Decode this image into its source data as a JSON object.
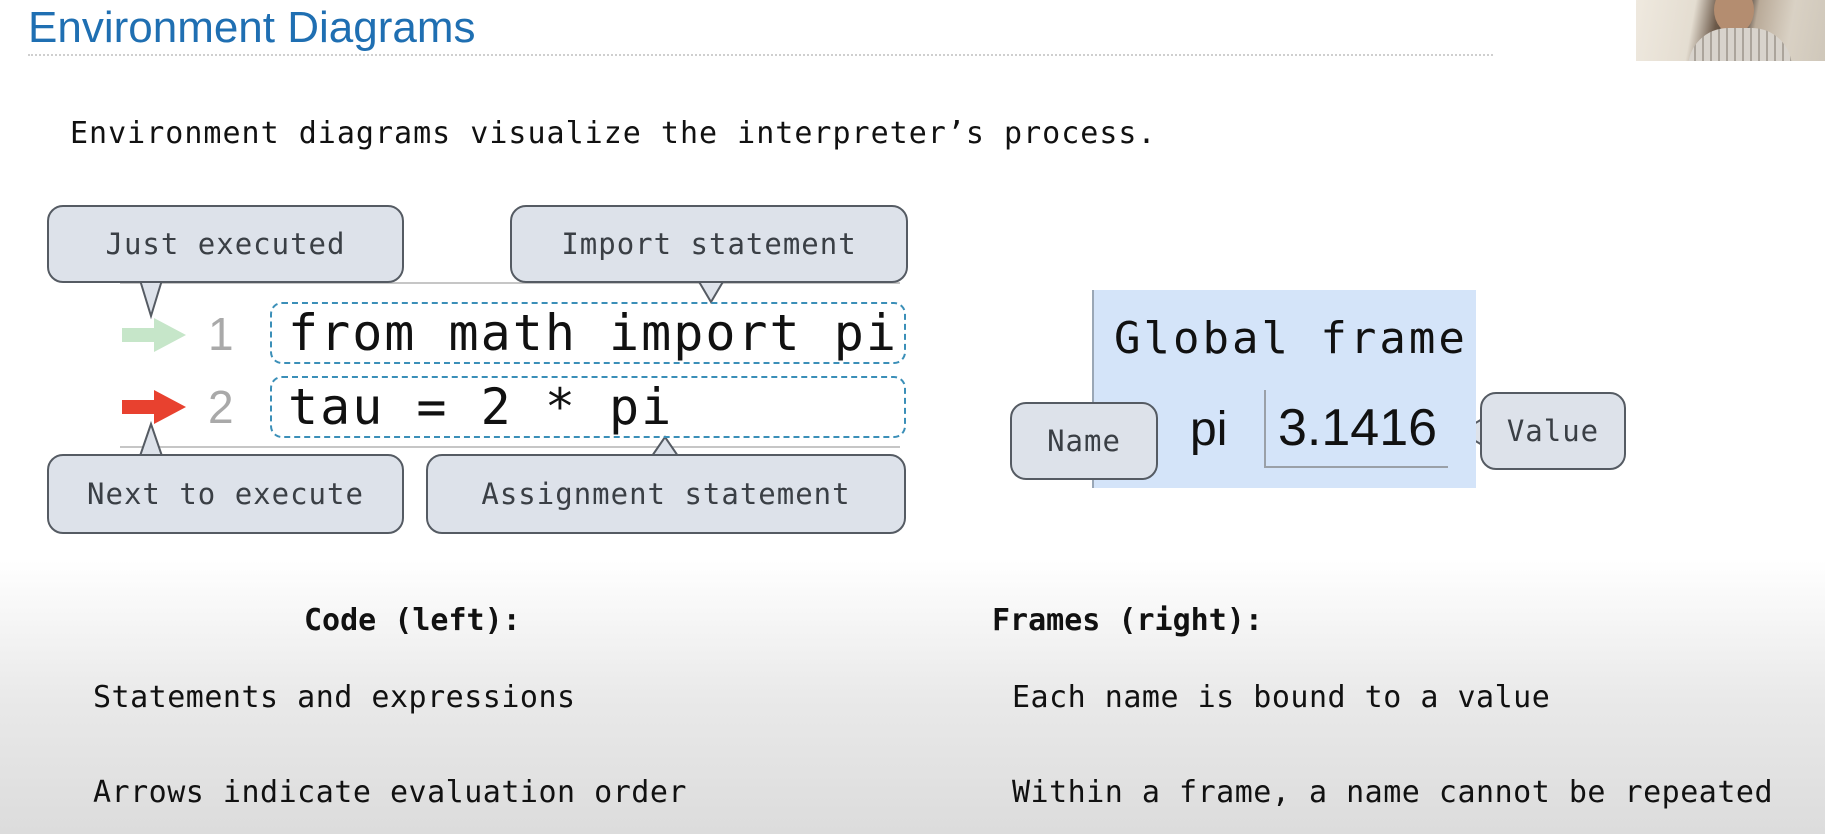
{
  "slide": {
    "title": "Environment Diagrams",
    "intro": "Environment diagrams visualize the interpreter’s process."
  },
  "code": {
    "lines": [
      {
        "number": "1",
        "text": "from math import pi"
      },
      {
        "number": "2",
        "text": "tau = 2 * pi"
      }
    ],
    "callouts": {
      "just_executed": "Just executed",
      "import_statement": "Import statement",
      "next_to_execute": "Next to execute",
      "assignment_statement": "Assignment statement"
    },
    "arrows": {
      "just_executed_color": "#c6e6c9",
      "next_to_execute_color": "#e8412f"
    }
  },
  "frame": {
    "title": "Global frame",
    "binding_name": "pi",
    "binding_value": "3.1416",
    "name_callout": "Name",
    "value_callout": "Value",
    "background_color": "#d4e4f9"
  },
  "left_column": {
    "heading": "Code (left):",
    "items": [
      "Statements and expressions",
      "Arrows indicate evaluation order"
    ]
  },
  "right_column": {
    "heading": "Frames (right):",
    "items": [
      "Each name is bound to a value",
      "Within a frame, a name cannot be repeated"
    ]
  },
  "colors": {
    "title": "#1f6fb2",
    "callout_fill": "#dde2ea",
    "code_box_border": "#3b8fb8"
  }
}
